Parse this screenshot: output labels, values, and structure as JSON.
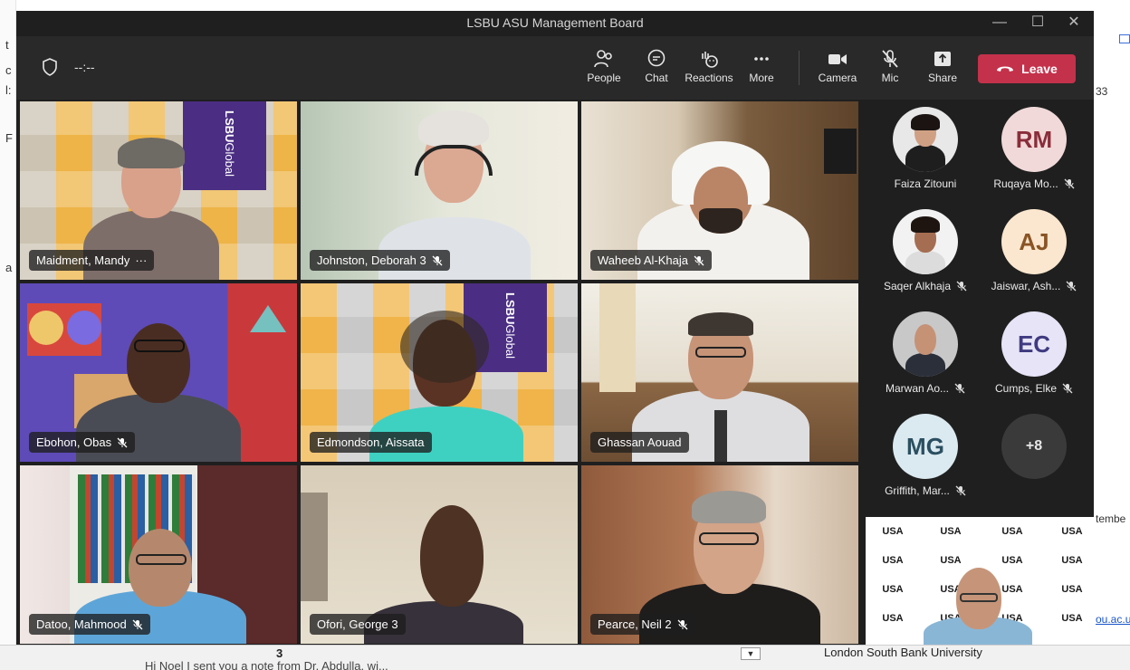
{
  "window": {
    "title": "LSBU ASU Management Board"
  },
  "toolbar": {
    "timer": "--:--",
    "people": "People",
    "chat": "Chat",
    "reactions": "Reactions",
    "more": "More",
    "camera": "Camera",
    "mic": "Mic",
    "share": "Share",
    "leave": "Leave"
  },
  "tiles": [
    {
      "name": "Maidment, Mandy",
      "suffix": "···"
    },
    {
      "name": "Johnston, Deborah 3"
    },
    {
      "name": "Waheeb Al-Khaja"
    },
    {
      "name": "Ebohon, Obas"
    },
    {
      "name": "Edmondson, Aissata"
    },
    {
      "name": "Ghassan Aouad"
    },
    {
      "name": "Datoo, Mahmood"
    },
    {
      "name": "Ofori, George 3"
    },
    {
      "name": "Pearce, Neil 2"
    }
  ],
  "brand": {
    "lsbu": "LSBU",
    "global": "Global"
  },
  "roster": [
    {
      "name": "Faiza Zitouni",
      "initials": ""
    },
    {
      "name": "Ruqaya Mo...",
      "initials": "RM"
    },
    {
      "name": "Saqer Alkhaja",
      "initials": ""
    },
    {
      "name": "Jaiswar, Ash...",
      "initials": "AJ"
    },
    {
      "name": "Marwan Ao...",
      "initials": ""
    },
    {
      "name": "Cumps, Elke",
      "initials": "EC"
    },
    {
      "name": "Griffith, Mar...",
      "initials": "MG"
    },
    {
      "name": "",
      "initials": "+8"
    }
  ],
  "selfview": {
    "logo": "USA"
  },
  "background": {
    "page_number": "3",
    "footer_org": "London South Bank University",
    "right_count": "33",
    "right_text_1": "tembe",
    "right_text_2": "ou.ac.u",
    "snippet": "Hi Noel I sent you a note from Dr. Abdulla, wi..."
  },
  "colors": {
    "window_bg": "#1f1f1f",
    "toolbar_bg": "#292929",
    "leave_red": "#c4314b",
    "asu_gold": "#f0b93a",
    "lsbu_purple": "#4b2e83"
  }
}
